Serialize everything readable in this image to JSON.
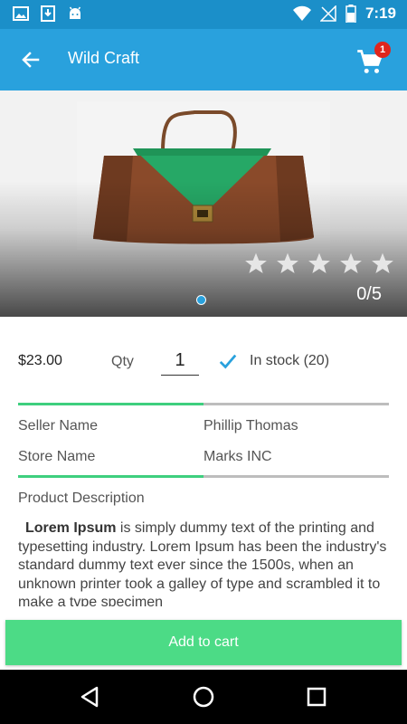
{
  "status_bar": {
    "time": "7:19",
    "icons": [
      "gallery-icon",
      "download-icon",
      "android-icon",
      "wifi-icon",
      "no-signal-icon",
      "battery-icon"
    ]
  },
  "toolbar": {
    "title": "Wild Craft",
    "cart_count": "1",
    "accent_color": "#29a1dd"
  },
  "hero": {
    "rating_text": "0/5",
    "stars_total": 5,
    "stars_filled": 0
  },
  "product": {
    "price": "$23.00",
    "qty_label": "Qty",
    "qty_value": "1",
    "stock_text": "In stock (20)"
  },
  "info": {
    "seller_label": "Seller Name",
    "seller_value": "Phillip Thomas",
    "store_label": "Store Name",
    "store_value": "Marks INC"
  },
  "description": {
    "heading": "Product Description",
    "lead": "Lorem Ipsum",
    "body": " is simply dummy text of the printing and typesetting industry. Lorem Ipsum has been the industry's standard dummy text ever since the 1500s, when an unknown printer took a galley of type and scrambled it to make a type specimen"
  },
  "actions": {
    "add_to_cart_label": "Add to cart",
    "button_color": "#4cdb86"
  }
}
